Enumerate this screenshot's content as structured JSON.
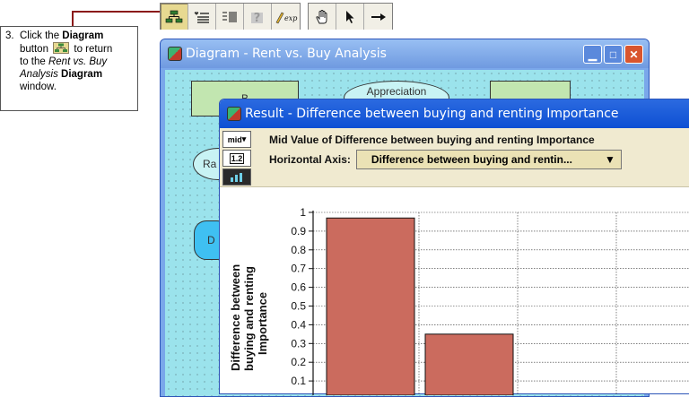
{
  "callout": {
    "number": "3.",
    "text_click": "Click the ",
    "text_diagram": "Diagram",
    "text_button": "button",
    "text_to_return": " to return",
    "text_to_the": "to the ",
    "text_rent_vs_buy": "Rent vs. Buy",
    "text_analysis": "Analysis",
    "text_diagram2": "Diagram",
    "text_window": "window."
  },
  "toolbar": {
    "buttons": [
      {
        "icon": "diagram-icon",
        "pressed": true
      },
      {
        "icon": "outline-icon"
      },
      {
        "icon": "attribute-panel-icon"
      },
      {
        "icon": "help-icon"
      },
      {
        "icon": "expr-icon",
        "label": "expr"
      },
      {
        "icon": "hand-icon"
      },
      {
        "icon": "arrow-pointer-icon"
      },
      {
        "icon": "arrow-connect-icon"
      }
    ]
  },
  "diagram_window": {
    "title": "Diagram - Rent vs. Buy Analysis",
    "nodes": [
      {
        "label": "B"
      },
      {
        "label": "Appreciation"
      },
      {
        "label": "Ra"
      },
      {
        "label": "D"
      }
    ]
  },
  "result_window": {
    "title": "Result - Difference between buying and renting Importance",
    "view_menu": "mid",
    "tool_1_2": "1.2",
    "subtitle": "Mid Value of Difference between buying and renting Importance",
    "horizontal_axis_label": "Horizontal Axis:",
    "horizontal_axis_value": "Difference between buying and rentin..."
  },
  "chart_data": {
    "type": "bar",
    "ylabel": "Difference between buying and renting Importance",
    "ylim": [
      0.1,
      1
    ],
    "yticks": [
      "1",
      "0.9",
      "0.8",
      "0.7",
      "0.6",
      "0.5",
      "0.4",
      "0.3",
      "0.2",
      "0.1"
    ],
    "values": [
      0.97,
      0.35
    ],
    "bar_color": "#cb6b5e",
    "grid": true
  }
}
